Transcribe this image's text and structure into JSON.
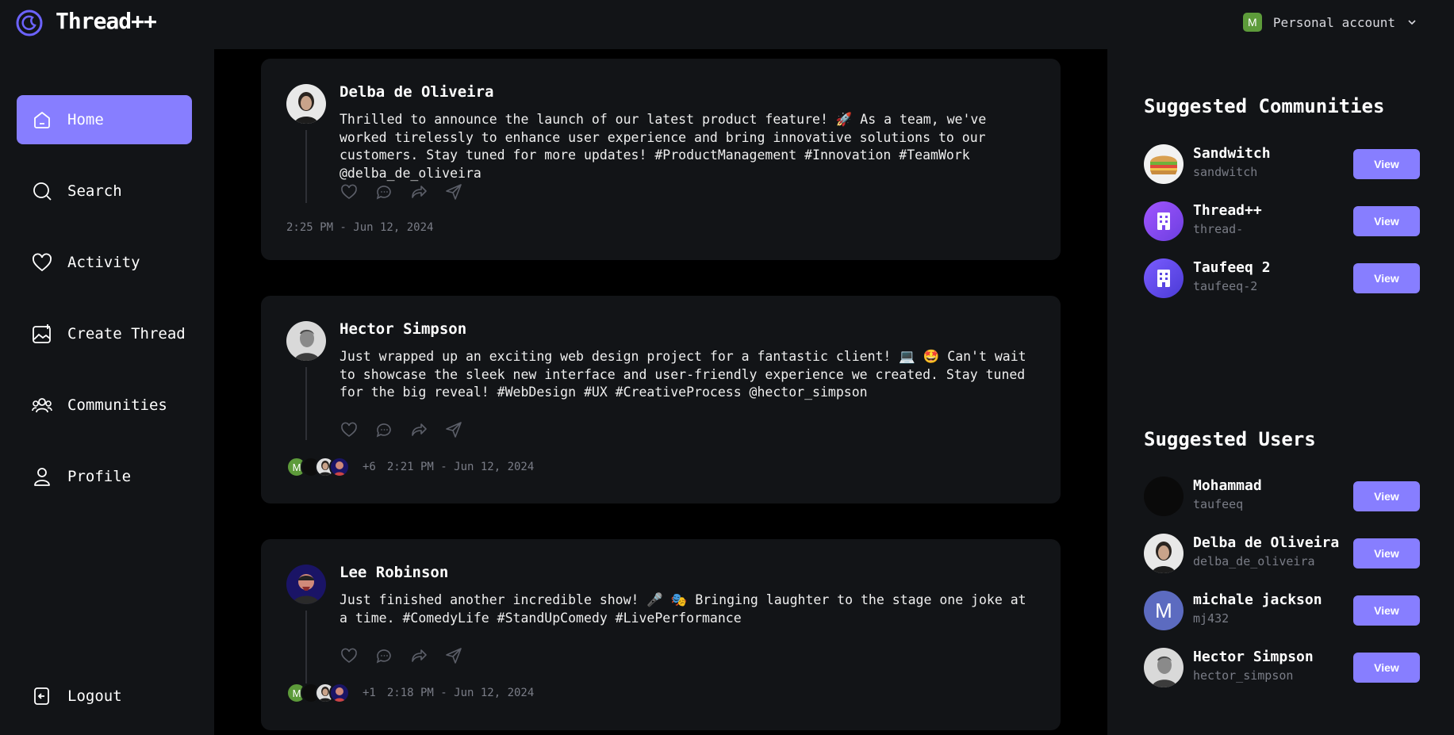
{
  "app": {
    "name": "Thread++",
    "account_label": "Personal account",
    "account_initial": "M"
  },
  "sidebar": {
    "items": [
      {
        "label": "Home",
        "icon": "home-icon",
        "active": true
      },
      {
        "label": "Search",
        "icon": "search-icon"
      },
      {
        "label": "Activity",
        "icon": "heart-icon"
      },
      {
        "label": "Create Thread",
        "icon": "create-thread-icon"
      },
      {
        "label": "Communities",
        "icon": "communities-icon"
      },
      {
        "label": "Profile",
        "icon": "profile-icon"
      }
    ],
    "logout_label": "Logout"
  },
  "posts": [
    {
      "author": "Delba de Oliveira",
      "content": "Thrilled to announce the launch of our latest product feature! 🚀 As a team, we've worked tirelessly to enhance user experience and bring innovative solutions to our customers. Stay tuned for more updates! #ProductManagement #Innovation #TeamWork @delba_de_oliveira",
      "timestamp": "2:25 PM - Jun 12, 2024",
      "reply_count": ""
    },
    {
      "author": "Hector Simpson",
      "content": "Just wrapped up an exciting web design project for a fantastic client! 💻 🤩 Can't wait to showcase the sleek new interface and user-friendly experience we created. Stay tuned for the big reveal! #WebDesign #UX #CreativeProcess @hector_simpson",
      "timestamp": "2:21 PM - Jun 12, 2024",
      "reply_count": "+6",
      "reply_initial": "M"
    },
    {
      "author": "Lee Robinson",
      "content": "Just finished another incredible show! 🎤 🎭 Bringing laughter to the stage one joke at a time. #ComedyLife #StandUpComedy #LivePerformance",
      "timestamp": "2:18 PM - Jun 12, 2024",
      "reply_count": "+1",
      "reply_initial": "M"
    }
  ],
  "suggested_communities": {
    "title": "Suggested Communities",
    "items": [
      {
        "name": "Sandwitch",
        "handle": "sandwitch",
        "button": "View",
        "icon": "sandwich-icon"
      },
      {
        "name": "Thread++",
        "handle": "thread-",
        "button": "View",
        "icon": "building-icon"
      },
      {
        "name": "Taufeeq 2",
        "handle": "taufeeq-2",
        "button": "View",
        "icon": "building-icon"
      }
    ]
  },
  "suggested_users": {
    "title": "Suggested Users",
    "items": [
      {
        "name": "Mohammad",
        "handle": "taufeeq",
        "button": "View"
      },
      {
        "name": "Delba de Oliveira",
        "handle": "delba_de_oliveira",
        "button": "View"
      },
      {
        "name": "michale jackson",
        "handle": "mj432",
        "button": "View",
        "initial": "M"
      },
      {
        "name": "Hector Simpson",
        "handle": "hector_simpson",
        "button": "View"
      }
    ]
  },
  "colors": {
    "accent": "#877eff",
    "panel": "#121417",
    "background": "#000000",
    "muted": "#7a7d87"
  }
}
